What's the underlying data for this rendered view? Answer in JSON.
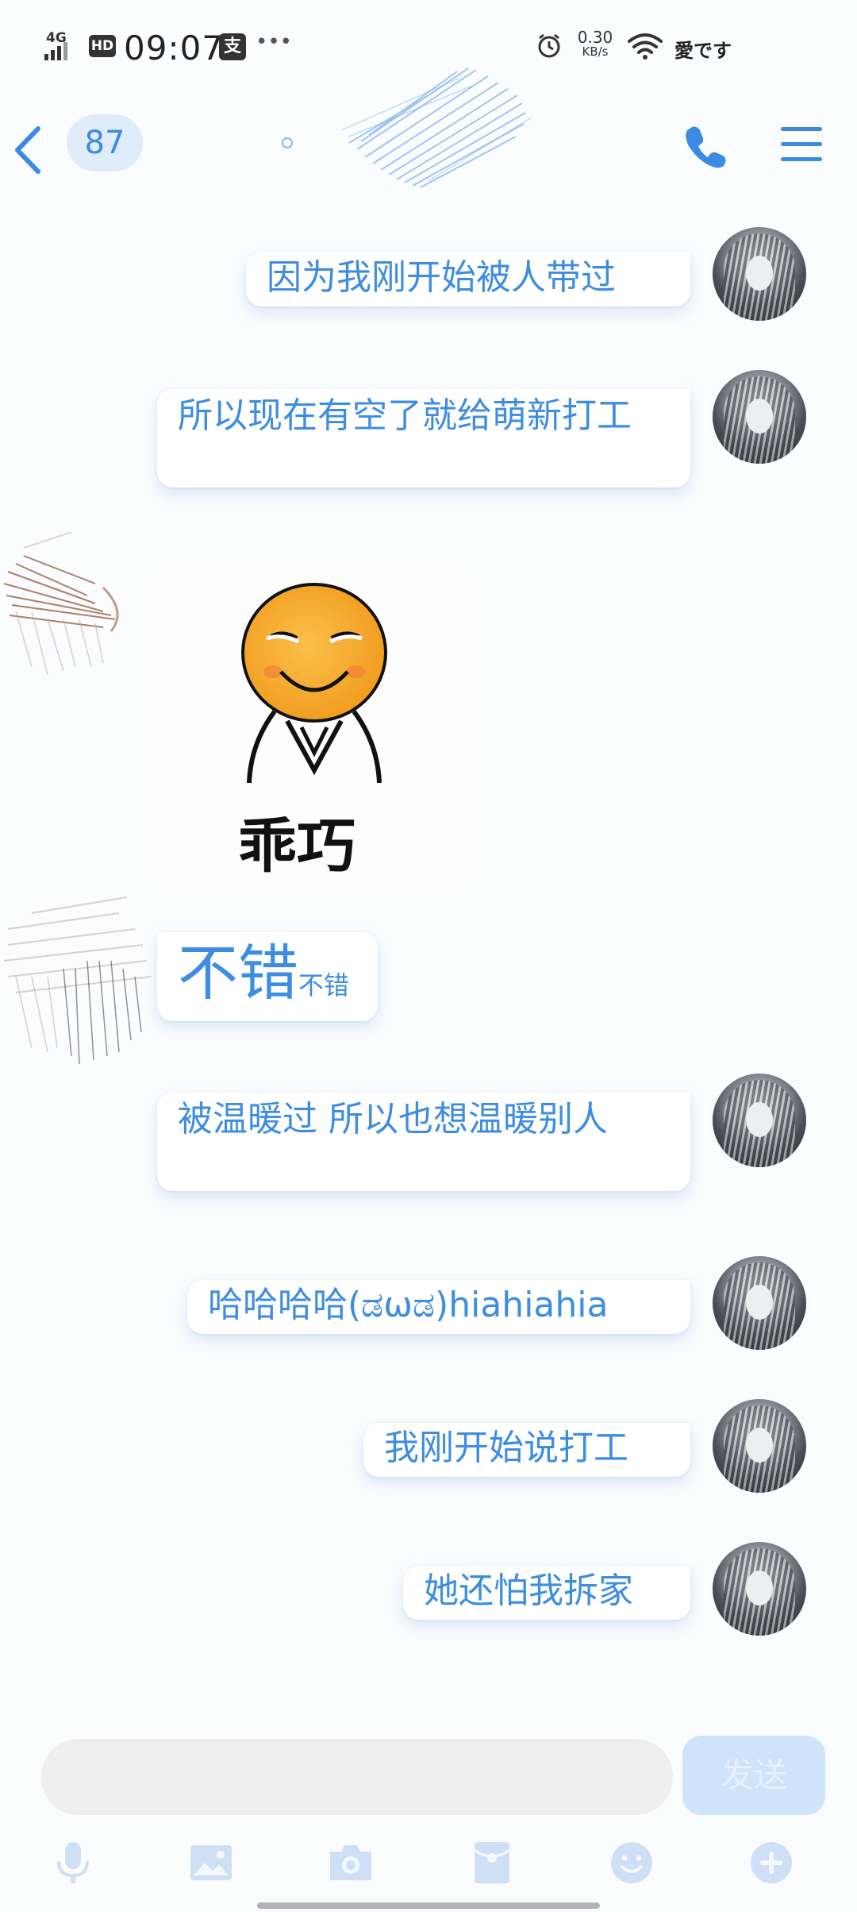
{
  "status_bar": {
    "network": "4G",
    "hd": "HD",
    "time": "09:07",
    "pay_icon": "alipay-icon",
    "speed_value": "0.30",
    "speed_unit": "KB/s",
    "carrier": "愛です"
  },
  "header": {
    "unread_count": "87"
  },
  "messages": [
    {
      "side": "right",
      "text": "因为我刚开始被人带过"
    },
    {
      "side": "right",
      "text": "所以现在有空了就给萌新打工"
    },
    {
      "side": "left",
      "type": "sticker",
      "sticker_text": "乖巧"
    },
    {
      "side": "left",
      "text_big": "不错",
      "text_small": "不错"
    },
    {
      "side": "right",
      "text": "被温暖过 所以也想温暖别人"
    },
    {
      "side": "right",
      "text": "哈哈哈哈(ಡωಡ)hiahiahia"
    },
    {
      "side": "right",
      "text": "我刚开始说打工"
    },
    {
      "side": "right",
      "text": "她还怕我拆家"
    }
  ],
  "input_bar": {
    "placeholder": "",
    "send_label": "发送"
  },
  "toolbar_icons": [
    "microphone-icon",
    "image-icon",
    "camera-icon",
    "red-packet-icon",
    "emoji-icon",
    "plus-icon"
  ],
  "colors": {
    "accent": "#3b8be3",
    "bubble_text": "#3d8de0",
    "send_button_bg": "#cfe3fb"
  }
}
